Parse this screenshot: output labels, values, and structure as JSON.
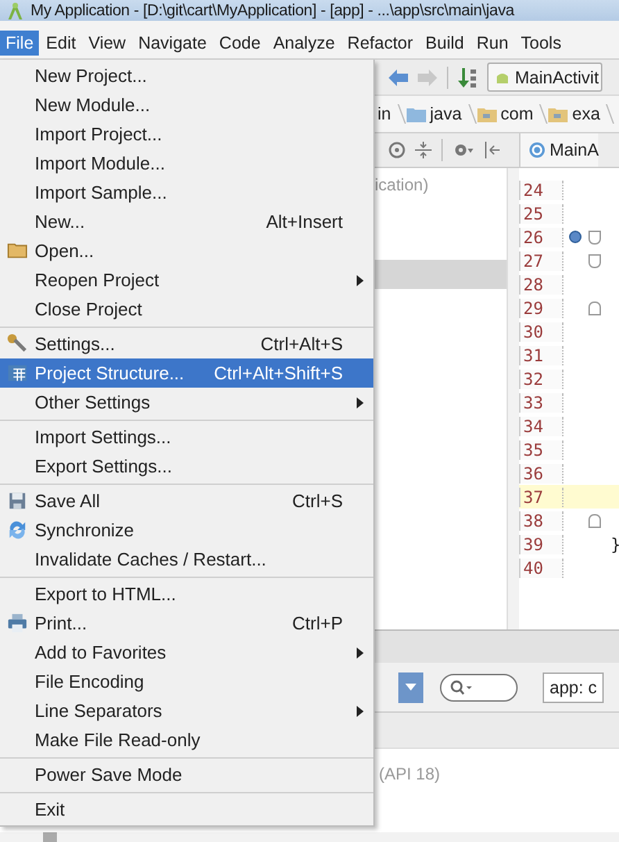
{
  "window": {
    "title": "My Application - [D:\\git\\cart\\MyApplication] - [app] - ...\\app\\src\\main\\java"
  },
  "menu_bar": [
    {
      "label": "File",
      "selected": true
    },
    {
      "label": "Edit",
      "selected": false
    },
    {
      "label": "View",
      "selected": false
    },
    {
      "label": "Navigate",
      "selected": false
    },
    {
      "label": "Code",
      "selected": false
    },
    {
      "label": "Analyze",
      "selected": false
    },
    {
      "label": "Refactor",
      "selected": false
    },
    {
      "label": "Build",
      "selected": false
    },
    {
      "label": "Run",
      "selected": false
    },
    {
      "label": "Tools",
      "selected": false
    }
  ],
  "file_menu": [
    {
      "kind": "item",
      "label": "New Project...",
      "selected": false
    },
    {
      "kind": "item",
      "label": "New Module...",
      "selected": false
    },
    {
      "kind": "item",
      "label": "Import Project...",
      "selected": false
    },
    {
      "kind": "item",
      "label": "Import Module...",
      "selected": false
    },
    {
      "kind": "item",
      "label": "Import Sample...",
      "selected": false
    },
    {
      "kind": "item",
      "label": "New...",
      "shortcut": "Alt+Insert",
      "selected": false
    },
    {
      "kind": "folder",
      "label": "Open...",
      "selected": false
    },
    {
      "kind": "item",
      "label": "Reopen Project",
      "submenu": true,
      "selected": false
    },
    {
      "kind": "item",
      "label": "Close Project",
      "selected": false
    },
    {
      "kind": "separator"
    },
    {
      "kind": "wrench",
      "label": "Settings...",
      "shortcut": "Ctrl+Alt+S",
      "selected": false
    },
    {
      "kind": "grid",
      "label": "Project Structure...",
      "shortcut": "Ctrl+Alt+Shift+S",
      "selected": true
    },
    {
      "kind": "item",
      "label": "Other Settings",
      "submenu": true,
      "selected": false
    },
    {
      "kind": "separator"
    },
    {
      "kind": "item",
      "label": "Import Settings...",
      "selected": false
    },
    {
      "kind": "item",
      "label": "Export Settings...",
      "selected": false
    },
    {
      "kind": "separator"
    },
    {
      "kind": "floppy",
      "label": "Save All",
      "shortcut": "Ctrl+S",
      "selected": false
    },
    {
      "kind": "sync",
      "label": "Synchronize",
      "selected": false
    },
    {
      "kind": "item",
      "label": "Invalidate Caches / Restart...",
      "selected": false
    },
    {
      "kind": "separator"
    },
    {
      "kind": "item",
      "label": "Export to HTML...",
      "selected": false
    },
    {
      "kind": "printer",
      "label": "Print...",
      "shortcut": "Ctrl+P",
      "selected": false
    },
    {
      "kind": "item",
      "label": "Add to Favorites",
      "submenu": true,
      "selected": false
    },
    {
      "kind": "item",
      "label": "File Encoding",
      "selected": false
    },
    {
      "kind": "item",
      "label": "Line Separators",
      "submenu": true,
      "selected": false
    },
    {
      "kind": "item",
      "label": "Make File Read-only",
      "selected": false
    },
    {
      "kind": "separator"
    },
    {
      "kind": "item",
      "label": "Power Save Mode",
      "selected": false
    },
    {
      "kind": "separator"
    },
    {
      "kind": "item",
      "label": "Exit",
      "selected": false
    }
  ],
  "toolbar": {
    "run_config": "MainActivit"
  },
  "breadcrumbs": [
    "in",
    "java",
    "com",
    "exa"
  ],
  "editor_tab": {
    "label": "MainA"
  },
  "project_panel": {
    "text": "ication)"
  },
  "gutter": [
    {
      "kind": "line",
      "number": "24"
    },
    {
      "kind": "line",
      "number": "25"
    },
    {
      "kind": "foldstart",
      "number": "26",
      "override": true
    },
    {
      "kind": "foldstart",
      "number": "27"
    },
    {
      "kind": "line",
      "number": "28"
    },
    {
      "kind": "foldend",
      "number": "29"
    },
    {
      "kind": "line",
      "number": "30"
    },
    {
      "kind": "line",
      "number": "31"
    },
    {
      "kind": "line",
      "number": "32"
    },
    {
      "kind": "line",
      "number": "33"
    },
    {
      "kind": "line",
      "number": "34"
    },
    {
      "kind": "line",
      "number": "35"
    },
    {
      "kind": "line",
      "number": "36"
    },
    {
      "kind": "line",
      "number": "37",
      "highlighted": true
    },
    {
      "kind": "foldend",
      "number": "38"
    },
    {
      "kind": "line",
      "number": "39",
      "code": "}"
    },
    {
      "kind": "line",
      "number": "40"
    }
  ],
  "device_panel": {
    "filter_value": "app: c",
    "api_text": "(API 18)"
  }
}
